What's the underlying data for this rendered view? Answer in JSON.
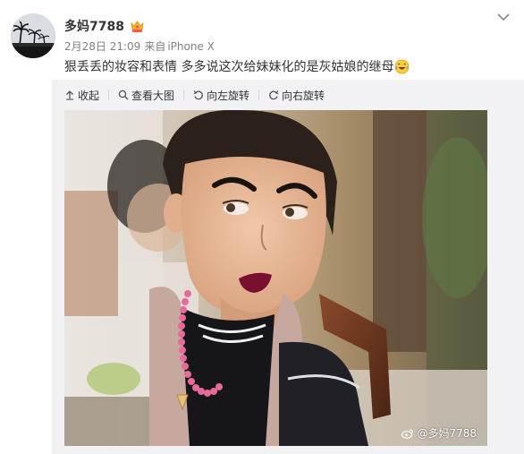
{
  "user": {
    "name": "多妈7788",
    "date": "2月28日 21:09",
    "source_prefix": "来自",
    "source": "iPhone X"
  },
  "post": {
    "text": "狠丢丢的妆容和表情 多多说这次给妹妹化的是灰姑娘的继母"
  },
  "toolbar": {
    "collapse": "收起",
    "view_large": "查看大图",
    "rotate_left": "向左旋转",
    "rotate_right": "向右旋转"
  },
  "watermark": {
    "text": "@多妈7788"
  },
  "icons": {
    "vip": "vip-badge-icon",
    "emoji": "laughing-tears-emoji-icon",
    "menu": "chevron-down-icon"
  },
  "colors": {
    "text": "#333333",
    "meta": "#808080",
    "media_bg": "#f2f2f5"
  }
}
